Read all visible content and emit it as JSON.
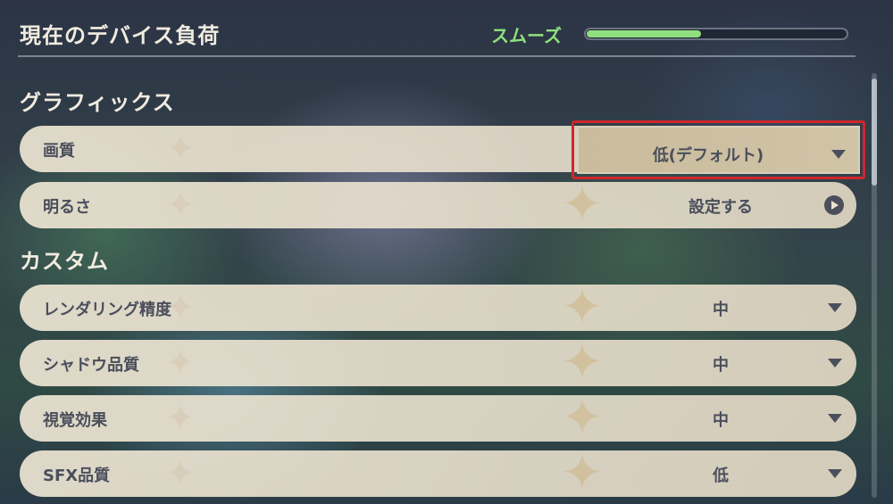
{
  "header": {
    "title": "現在のデバイス負荷",
    "status": "スムーズ",
    "load_fraction": 0.44
  },
  "sections": {
    "graphics": {
      "title": "グラフィックス",
      "quality": {
        "label": "画質",
        "value": "低(デフォルト)"
      },
      "brightness": {
        "label": "明るさ",
        "value": "設定する"
      }
    },
    "custom": {
      "title": "カスタム",
      "render": {
        "label": "レンダリング精度",
        "value": "中"
      },
      "shadow": {
        "label": "シャドウ品質",
        "value": "中"
      },
      "visual": {
        "label": "視覚効果",
        "value": "中"
      },
      "sfx": {
        "label": "SFX品質",
        "value": "低"
      }
    }
  },
  "colors": {
    "status_green": "#8fe07c",
    "highlight_red": "#d0262d",
    "row_bg": "#ece4d2",
    "text_dark": "#4b4f5c"
  },
  "icons": [
    "dropdown-caret-icon",
    "play-circle-icon"
  ]
}
